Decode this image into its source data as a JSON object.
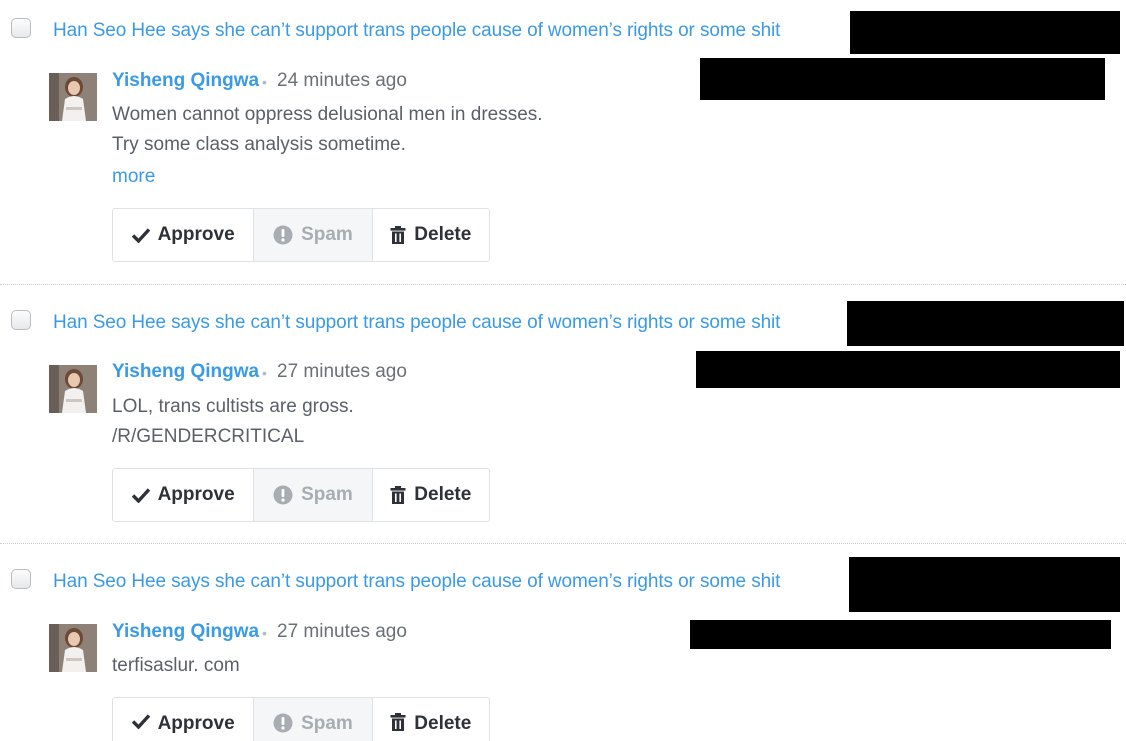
{
  "comments": [
    {
      "thread_title": "Han Seo Hee says she can’t support trans people cause of women’s rights or some shit",
      "author": "Yisheng Qingwa",
      "separator": "•",
      "time": "24 minutes ago",
      "body": [
        "Women cannot oppress delusional men in dresses.",
        "Try some class analysis sometime."
      ],
      "more_label": "more"
    },
    {
      "thread_title": "Han Seo Hee says she can’t support trans people cause of women’s rights or some shit",
      "author": "Yisheng Qingwa",
      "separator": "•",
      "time": "27 minutes ago",
      "body": [
        "LOL, trans cultists are gross.",
        "/R/GENDERCRITICAL"
      ]
    },
    {
      "thread_title": "Han Seo Hee says she can’t support trans people cause of women’s rights or some shit",
      "author": "Yisheng Qingwa",
      "separator": "•",
      "time": "27 minutes ago",
      "body": [
        "terfisaslur. com"
      ]
    }
  ],
  "actions": {
    "approve_label": "Approve",
    "spam_label": "Spam",
    "delete_label": "Delete",
    "approve_icon": "checkmark-icon",
    "spam_icon": "exclamation-circle-icon",
    "delete_icon": "trash-icon"
  },
  "colors": {
    "link": "#3a9ae6",
    "redaction": "#000000"
  }
}
